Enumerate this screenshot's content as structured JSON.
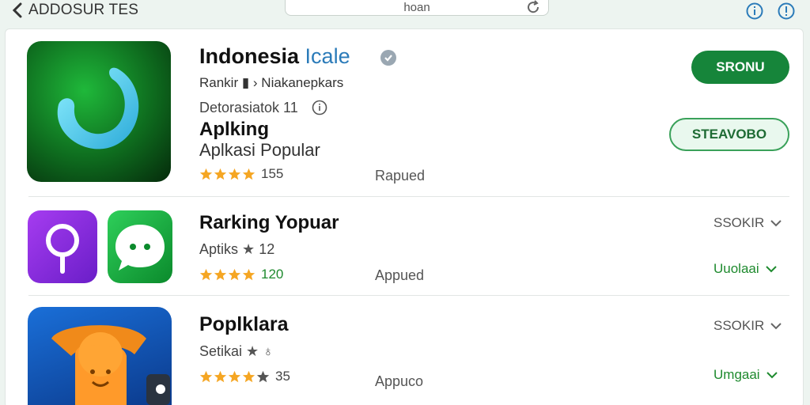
{
  "topbar": {
    "back_label": "ADDOSUR TES",
    "search_text": "hoan"
  },
  "featured": {
    "title": "Indonesia",
    "title_accent": "Icale",
    "line1": "Rankir  ▮  › Niakanepkars",
    "line2": "Detorasiatok 11",
    "heading": "Aplking",
    "subheading": "Aplkasi Popular",
    "rating_count": "155",
    "status": "Rapued",
    "primary_button": "SRONU",
    "secondary_button": "STEAVOBO"
  },
  "rows": [
    {
      "title": "Rarking Yopuar",
      "subtitle": "Aptiks",
      "subtitle_tail": "12",
      "rating_count": "120",
      "status": "Appued",
      "dropdown_top": "SSOKIR",
      "dropdown_bottom": "Uuolaai"
    },
    {
      "title": "Poplklara",
      "subtitle": "Setikai",
      "subtitle_tail": "",
      "rating_count": "35",
      "status": "Appuco",
      "dropdown_top": "SSOKIR",
      "dropdown_bottom": "Umgaai"
    }
  ],
  "ratings": {
    "featured_stars": 4,
    "row1_stars": 4,
    "row2_stars": 4.5
  },
  "colors": {
    "accent_green": "#16853a",
    "star": "#f5a623",
    "link_blue": "#2b7bb9"
  }
}
